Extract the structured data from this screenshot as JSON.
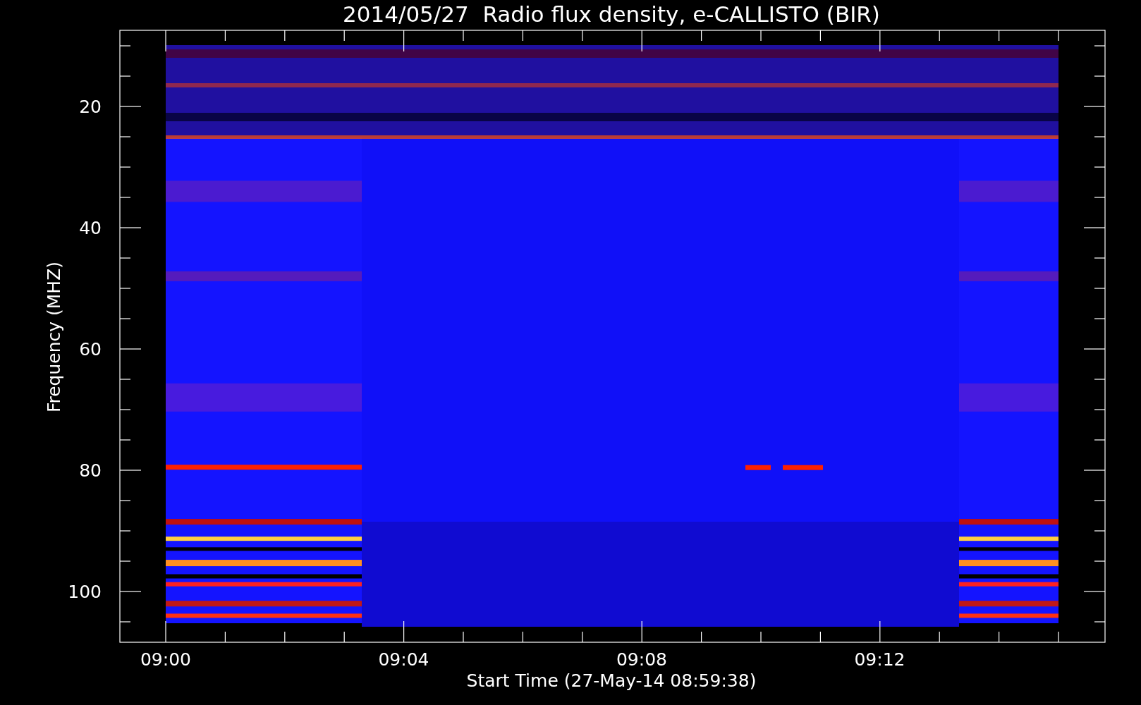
{
  "title": "2014/05/27  Radio flux density, e-CALLISTO (BIR)",
  "y_axis": {
    "label": "Frequency (MHZ)",
    "ticks": [
      "20",
      "40",
      "60",
      "80",
      "100"
    ]
  },
  "x_axis": {
    "label": "Start Time (27-May-14 08:59:38)",
    "ticks": [
      "09:00",
      "09:04",
      "09:08",
      "09:12"
    ]
  }
}
